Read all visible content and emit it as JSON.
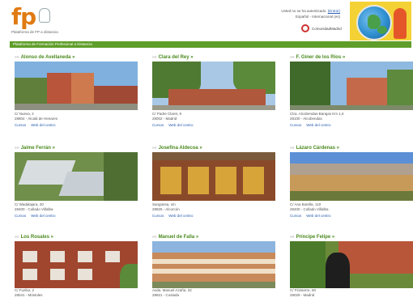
{
  "header": {
    "logo_text": "fp",
    "logo_subtitle": "Plataforma de FP a distancia",
    "top_line1": "Usted no se ha autenticado.",
    "login_link": "(Entrar)",
    "top_line2": "Español - Internacional (es)",
    "cm_logo_text": "ComunidadMadrid"
  },
  "greenbar_text": "Plataforma de Formación Profesional a Distancia",
  "colors": {
    "accent_green": "#5f9e2a",
    "title_green": "#4a8a1e",
    "link_blue": "#2a5db0",
    "logo_orange": "#e07b12"
  },
  "centers": [
    {
      "title": "Alonso de Avellaneda",
      "arrow": "»",
      "addr1": "C/ Nueva, 2",
      "addr2": "28804 - Alcalá de Henares",
      "link1": "Cursos",
      "link2": "Web del centro"
    },
    {
      "title": "Clara del Rey",
      "arrow": "»",
      "addr1": "C/ Padre Claret, 8",
      "addr2": "28002 - Madrid",
      "link1": "Cursos",
      "link2": "Web del centro"
    },
    {
      "title": "F. Giner de los Ríos",
      "arrow": "»",
      "addr1": "Ctra. Alcobendas-Barajas Km 1,6",
      "addr2": "28100 - Alcobendas",
      "link1": "Cursos",
      "link2": "Web del centro"
    },
    {
      "title": "Jaime Ferrán",
      "arrow": "»",
      "addr1": "C/ Wadalajara, 20",
      "addr2": "28400 - Collado Villalba",
      "link1": "Cursos",
      "link2": "Web del centro"
    },
    {
      "title": "Josefina Aldecoa",
      "arrow": "»",
      "addr1": "Sangüesa, s/n",
      "addr2": "28925 - Alcorcón",
      "link1": "Cursos",
      "link2": "Web del centro"
    },
    {
      "title": "Lázaro Cárdenas",
      "arrow": "»",
      "addr1": "C/ Ana Botella, 110",
      "addr2": "28400 - Collado Villalba",
      "link1": "Cursos",
      "link2": "Web del centro"
    },
    {
      "title": "Los Rosales",
      "arrow": "»",
      "addr1": "C/ Fuzilar, 2",
      "addr2": "28041 - Móstoles",
      "link1": "",
      "link2": ""
    },
    {
      "title": "Manuel de Falla",
      "arrow": "»",
      "addr1": "Avda. Manuel Azaña, 32",
      "addr2": "28821 - Coslada",
      "link1": "",
      "link2": ""
    },
    {
      "title": "Príncipe Felipe",
      "arrow": "»",
      "addr1": "C/ Finisterre, 60",
      "addr2": "28029 - Madrid",
      "link1": "",
      "link2": ""
    }
  ]
}
